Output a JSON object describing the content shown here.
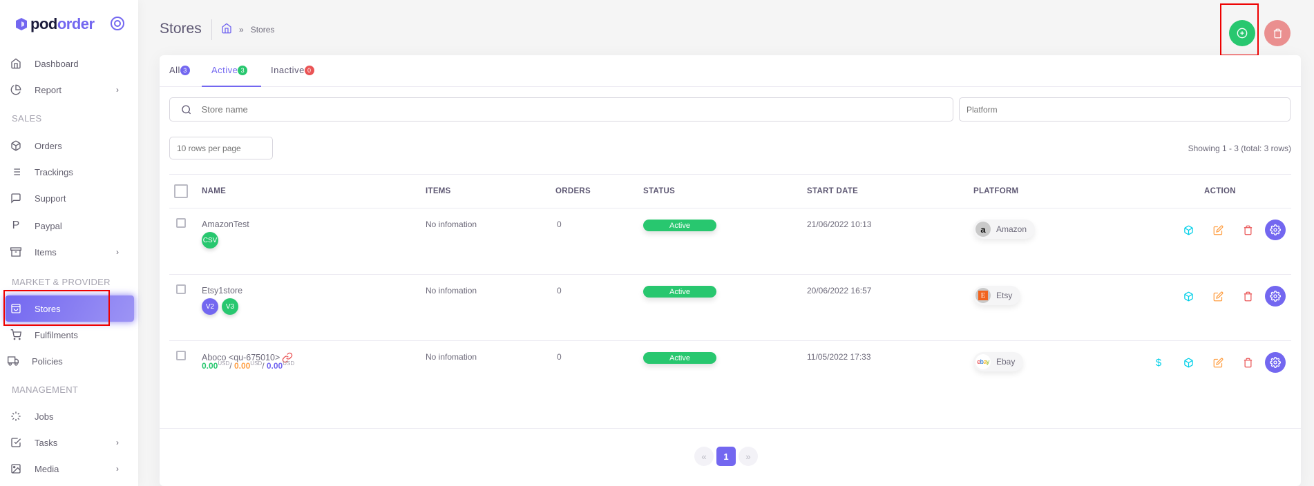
{
  "brand": {
    "name_part1": "pod",
    "name_part2": "order"
  },
  "sidebar": {
    "items": [
      {
        "label": "Dashboard",
        "icon": "home-icon"
      },
      {
        "label": "Report",
        "icon": "pie-chart-icon",
        "has_children": true
      },
      {
        "section": "SALES"
      },
      {
        "label": "Orders",
        "icon": "package-icon"
      },
      {
        "label": "Trackings",
        "icon": "list-icon"
      },
      {
        "label": "Support",
        "icon": "message-square-icon"
      },
      {
        "label": "Paypal",
        "icon": "paypal-icon"
      },
      {
        "label": "Items",
        "icon": "archive-icon",
        "has_children": true
      },
      {
        "section": "MARKET & PROVIDER"
      },
      {
        "label": "Stores",
        "icon": "shopping-bag-icon",
        "active": true
      },
      {
        "label": "Fulfilments",
        "icon": "shopping-cart-icon"
      },
      {
        "label": "Policies",
        "icon": "truck-icon"
      },
      {
        "section": "MANAGEMENT"
      },
      {
        "label": "Jobs",
        "icon": "loader-icon"
      },
      {
        "label": "Tasks",
        "icon": "check-square-icon",
        "has_children": true
      },
      {
        "label": "Media",
        "icon": "image-icon",
        "has_children": true
      }
    ],
    "chevron": "›"
  },
  "header": {
    "title": "Stores",
    "breadcrumb": {
      "sep": "»",
      "current": "Stores"
    },
    "add_button": "add-circle-icon",
    "delete_button": "trash-icon"
  },
  "tabs": [
    {
      "label": "All",
      "count": "3",
      "color": "#7367f0"
    },
    {
      "label": "Active",
      "count": "3",
      "color": "#28c76f",
      "active": true
    },
    {
      "label": "Inactive",
      "count": "0",
      "color": "#ea5455"
    }
  ],
  "filters": {
    "search_placeholder": "Store name",
    "platform_placeholder": "Platform",
    "rows_per_page": "10 rows per page",
    "showing": "Showing 1 - 3 (total: 3 rows)"
  },
  "table": {
    "columns": [
      "NAME",
      "ITEMS",
      "ORDERS",
      "STATUS",
      "START DATE",
      "PLATFORM",
      "ACTION"
    ],
    "rows": [
      {
        "name": "AmazonTest",
        "tags": [
          {
            "label": "CSV",
            "color": "#28c76f"
          }
        ],
        "items": "No infomation",
        "orders": "0",
        "status": "Active",
        "start_date": "21/06/2022 10:13",
        "platform": "Amazon",
        "platform_logo": "a"
      },
      {
        "name": "Etsy1store",
        "tags": [
          {
            "label": "V2",
            "color": "#7367f0"
          },
          {
            "label": "V3",
            "color": "#28c76f"
          }
        ],
        "items": "No infomation",
        "orders": "0",
        "status": "Active",
        "start_date": "20/06/2022 16:57",
        "platform": "Etsy",
        "platform_logo": "E"
      },
      {
        "name": "Aboco <qu-675010>",
        "balances": [
          {
            "value": "0.00",
            "unit": "USD",
            "color": "#28c76f"
          },
          {
            "value": "0.00",
            "unit": "USD",
            "color": "#ff9f43"
          },
          {
            "value": "0.00",
            "unit": "USD",
            "color": "#7367f0"
          }
        ],
        "balance_sep": "/",
        "items": "No infomation",
        "orders": "0",
        "status": "Active",
        "start_date": "11/05/2022 17:33",
        "platform": "Ebay",
        "platform_logo": "ebay"
      }
    ]
  },
  "pagination": {
    "prev": "«",
    "current": "1",
    "next": "»"
  }
}
